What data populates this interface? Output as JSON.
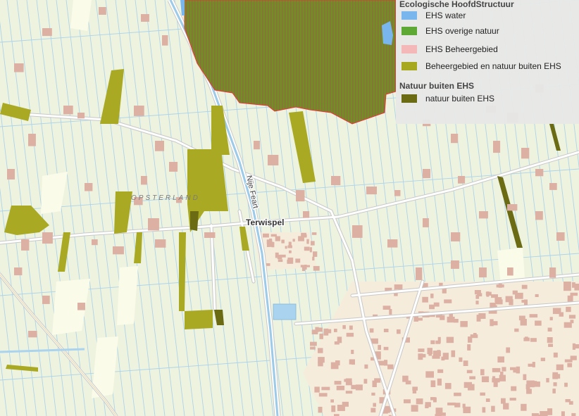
{
  "legend": {
    "section1_title": "Ecologische HoofdStructuur",
    "items": [
      {
        "label": "EHS water",
        "color": "#7ab6ee"
      },
      {
        "label": "EHS overige natuur",
        "color": "#5ea836"
      },
      {
        "label": "EHS Beheergebied",
        "color": "#f4b8b8"
      },
      {
        "label": "Beheergebied en natuur buiten EHS",
        "color": "#a8a81e"
      }
    ],
    "section2_title": "Natuur buiten EHS",
    "items2": [
      {
        "label": "natuur buiten EHS",
        "color": "#6b6b14"
      }
    ]
  },
  "map": {
    "place_terwispel": "Terwispel",
    "place_opsterland": "OPSTERLAND",
    "road_nije_feart": "Nije Feart",
    "colors": {
      "background": "#eef3df",
      "ditch": "#a9d2ea",
      "road": "#ffffff",
      "road_edge": "#c9c9c9",
      "building": "#dcb1a4",
      "urban_block": "#f6eddc",
      "ehs_stripe_a": "#6f8f22",
      "ehs_stripe_b": "#8a6e3a"
    }
  }
}
